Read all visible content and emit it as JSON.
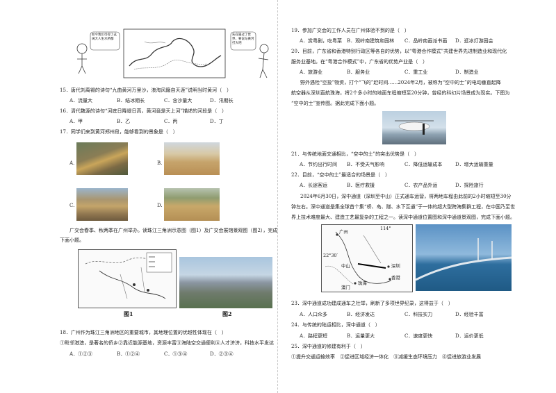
{
  "left": {
    "top_figure": {
      "bubble_left": "如今我们可得了这阔大人生水所都",
      "bubble_right": "先在篇过了世界，要说与黄河打大吧"
    },
    "q15": {
      "stem": "15．唐代刘禹锡的诗句“九曲黄河万里沙，浪淘风簸自天涯”说明当时黄河（　）",
      "options": [
        "A．流量大",
        "B．结冰期长",
        "C．含沙量大",
        "D．汛期长"
      ]
    },
    "q16": {
      "stem": "16．清代魏源的诗句“河底日降堤日高，黄河竟是天上河”描述的河段是（　）",
      "options": [
        "A．甲",
        "B．乙",
        "C．丙",
        "D．丁"
      ]
    },
    "q17": {
      "stem": "17．同学们来到黄河郑州段，能够看到的景象是（　）",
      "options": [
        "A.",
        "B.",
        "C.",
        "D."
      ]
    },
    "intro": [
      "广交会春季、秋两季在广州举办。读珠江三角洲示意图（图1）及广交会展馆景观图（图2），完成",
      "下面小题。"
    ],
    "figure_captions": [
      "图1",
      "图2"
    ],
    "q18": {
      "stem": "18．广州作为珠江三角洲地区的重要城市，其地理位置的优越性体现在（　）",
      "line2": "①毗邻港澳，是著名的侨乡②靠近能源基地，资源丰富③海陆空交通便利④人才济济，科技水平发达",
      "options": [
        "A．①②③",
        "B．①②④",
        "C．①③④",
        "D．②③④"
      ]
    }
  },
  "right": {
    "q19": {
      "stem": "19．参加广交会的工作人员在广州体验不到的是（　）",
      "options": [
        "A．赏粤剧，吃粤菜",
        "B．观岭南建筑和园林",
        "C．品岭南画派书画",
        "D．逛冰灯游园会"
      ]
    },
    "q20": {
      "stem": "20．目前，广东省和香港特别行政区等各自的优势，以“粤港合作模式”共建世界先进制造业和现代化",
      "line2": "服务业基地。在“粤港合作模式”中，广东省的优势产业是（　）",
      "options": [
        "A．旅游业",
        "B．服务业",
        "C．重工业",
        "D．制造业"
      ]
    },
    "intro2": [
      "野外遇险“空投”物资，打个“飞的”赶时间……2024年2月，被称为“空中的士”的电动垂直起降",
      "航空器从深圳直航珠海，将2个多小时的地面车程缩短至20分钟，曾经的科幻片场景成为现实。下图为",
      "“空中的士”宣传图。据此完成下面小题。"
    ],
    "q21": {
      "stem": "21．与传统地面交通相比，“空中的士”的突出优势是（　）",
      "options": [
        "A．节约出行时间",
        "B．不受天气影响",
        "C．降低运输成本",
        "D．增大运输重量"
      ]
    },
    "q22": {
      "stem": "22．目前，“空中的士”最适合的场景是（　）",
      "options": [
        "A．长途客运",
        "B．医疗救援",
        "C．农产品外运",
        "D．探险旅行"
      ]
    },
    "intro3": [
      "2024年6月30日，深中通道（深圳至中山）正式通车运营，将两地车程由此前的2小时缩短至30分",
      "钟左右。深中通道是集全球首个集“桥、岛、隧、水下互通”于一体的超大型跨海集群工程，在中国乃至世",
      "界上技术难度最大、建造工艺最复杂的工程之一。读深中通道位置图和深中通道景观图，完成下面小题。"
    ],
    "map_labels": {
      "guangzhou": "广州",
      "shenzhen": "深圳",
      "hongkong": "香港",
      "zhuhai": "珠海",
      "zhongshan": "中山",
      "macau": "澳门",
      "lon": "114°",
      "lat": "22°30′"
    },
    "q23": {
      "stem": "23．深中通道成功建成通车之壮举，刷新了多项世界纪录，这得益于（　）",
      "options": [
        "A．人口众多",
        "B．经济发达",
        "C．科技实力",
        "D．经验丰富"
      ]
    },
    "q24": {
      "stem": "24．与传统的陆运相比，深中通道（　）",
      "options": [
        "A．路程更短",
        "B．运量更大",
        "C．速度更快",
        "D．运价更低"
      ]
    },
    "q25": {
      "stem": "25．深中通道的修建有利于（　）",
      "line2": "①提升交通运输效率　②促进区域经济一体化　③减缓生态环境压力　④促进旅游业发展"
    }
  }
}
